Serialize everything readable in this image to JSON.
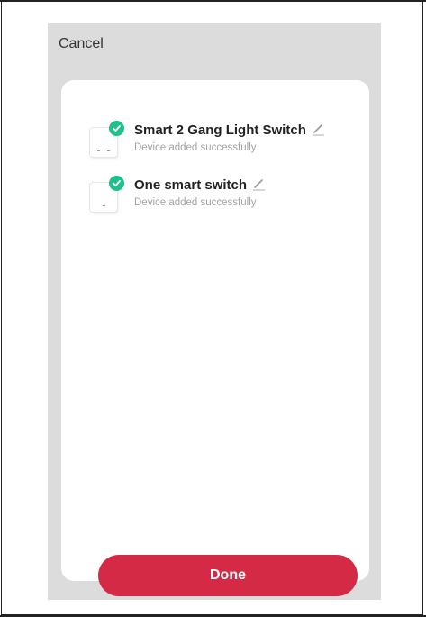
{
  "header": {
    "cancel_label": "Cancel"
  },
  "devices": [
    {
      "name": "Smart 2 Gang Light Switch",
      "status": "Device added successfully",
      "icon": "check-icon"
    },
    {
      "name": "One smart switch",
      "status": "Device added successfully",
      "icon": "check-icon"
    }
  ],
  "footer": {
    "done_label": "Done"
  },
  "colors": {
    "accent": "#d42a45",
    "success": "#20c08b",
    "backdrop": "#dcdcdc"
  }
}
